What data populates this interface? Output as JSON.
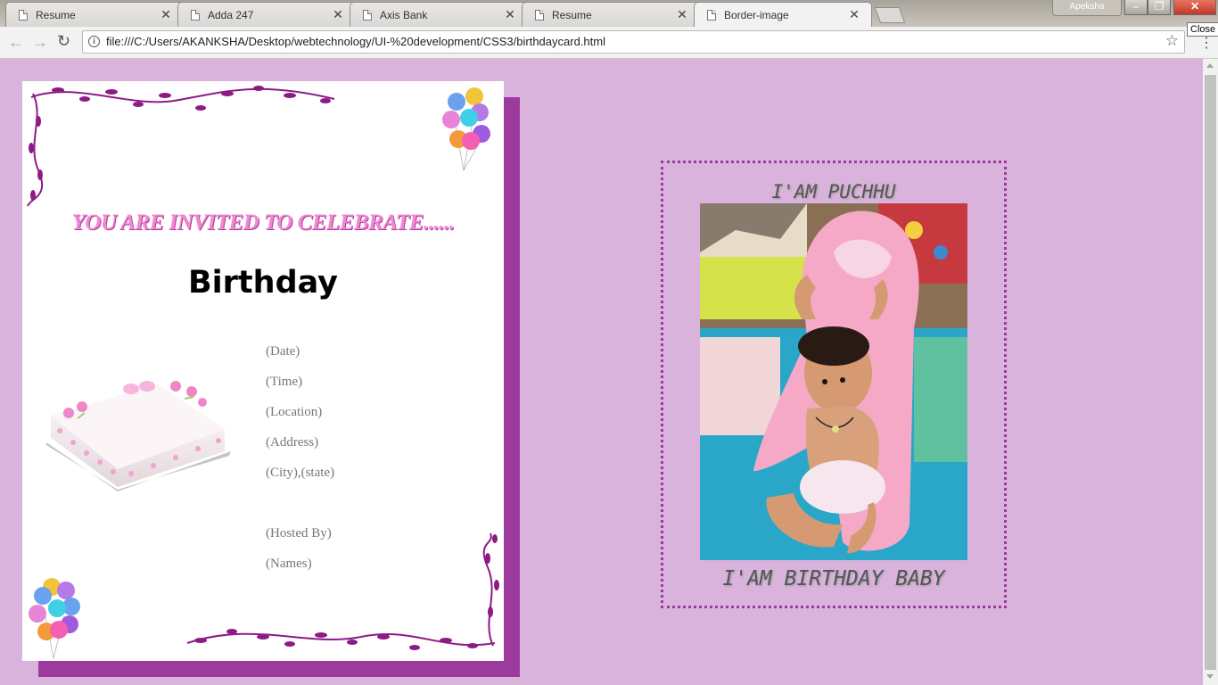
{
  "tabs": [
    {
      "title": "Resume"
    },
    {
      "title": "Adda 247"
    },
    {
      "title": "Axis Bank"
    },
    {
      "title": "Resume"
    },
    {
      "title": "Border-image"
    }
  ],
  "close_glyph": "✕",
  "window": {
    "profile_name": "Apeksha",
    "minimize": "–",
    "maximize": "❐",
    "close": "✕",
    "close_tooltip": "Close"
  },
  "toolbar": {
    "back": "←",
    "forward": "→",
    "reload": "↻",
    "url": "file:///C:/Users/AKANKSHA/Desktop/webtechnology/UI-%20development/CSS3/birthdaycard.html",
    "info": "i",
    "star": "☆",
    "menu": "⋮"
  },
  "card": {
    "invite": "YOU ARE INVITED TO CELEBRATE......",
    "heading": "Birthday",
    "details": [
      "(Date)",
      "(Time)",
      "(Location)",
      "(Address)",
      "(City),(state)",
      "",
      "(Hosted By)",
      "(Names)"
    ]
  },
  "photo_frame": {
    "top_caption": "I'AM PUCHHU",
    "bottom_caption": "I'AM BIRTHDAY BABY"
  },
  "colors": {
    "page_bg": "#dab3dd",
    "accent_purple": "#9c3a9e",
    "invite_pink": "#f08ad0"
  },
  "icons": [
    "page-icon",
    "close-icon",
    "back-icon",
    "forward-icon",
    "reload-icon",
    "info-icon",
    "star-icon",
    "menu-icon",
    "balloons-icon",
    "cake-image",
    "vine-decoration",
    "baby-photo"
  ]
}
